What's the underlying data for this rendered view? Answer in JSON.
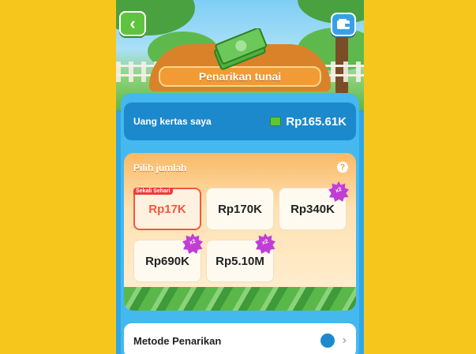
{
  "header": {
    "title": "Penarikan tunai",
    "back_icon": "chevron-left-icon",
    "wallet_icon": "wallet-icon"
  },
  "balance": {
    "label": "Uang kertas saya",
    "value": "Rp165.61K"
  },
  "amounts": {
    "title": "Pilih jumlah",
    "help": "?",
    "options": [
      {
        "label": "Rp17K",
        "tag": "Sekali Sehari",
        "selected": true
      },
      {
        "label": "Rp170K"
      },
      {
        "label": "Rp340K",
        "badge": "x2"
      },
      {
        "label": "Rp690K",
        "badge": "x2"
      },
      {
        "label": "Rp5.10M",
        "badge": "x2"
      }
    ]
  },
  "method": {
    "label": "Metode Penarikan",
    "icon": "wallet-icon",
    "chevron": "›"
  },
  "colors": {
    "background": "#f7c61c",
    "accent_orange": "#f29b34",
    "accent_blue": "#2fa6e6",
    "selected_red": "#ef5a3a",
    "badge_purple": "#c13ed6"
  }
}
